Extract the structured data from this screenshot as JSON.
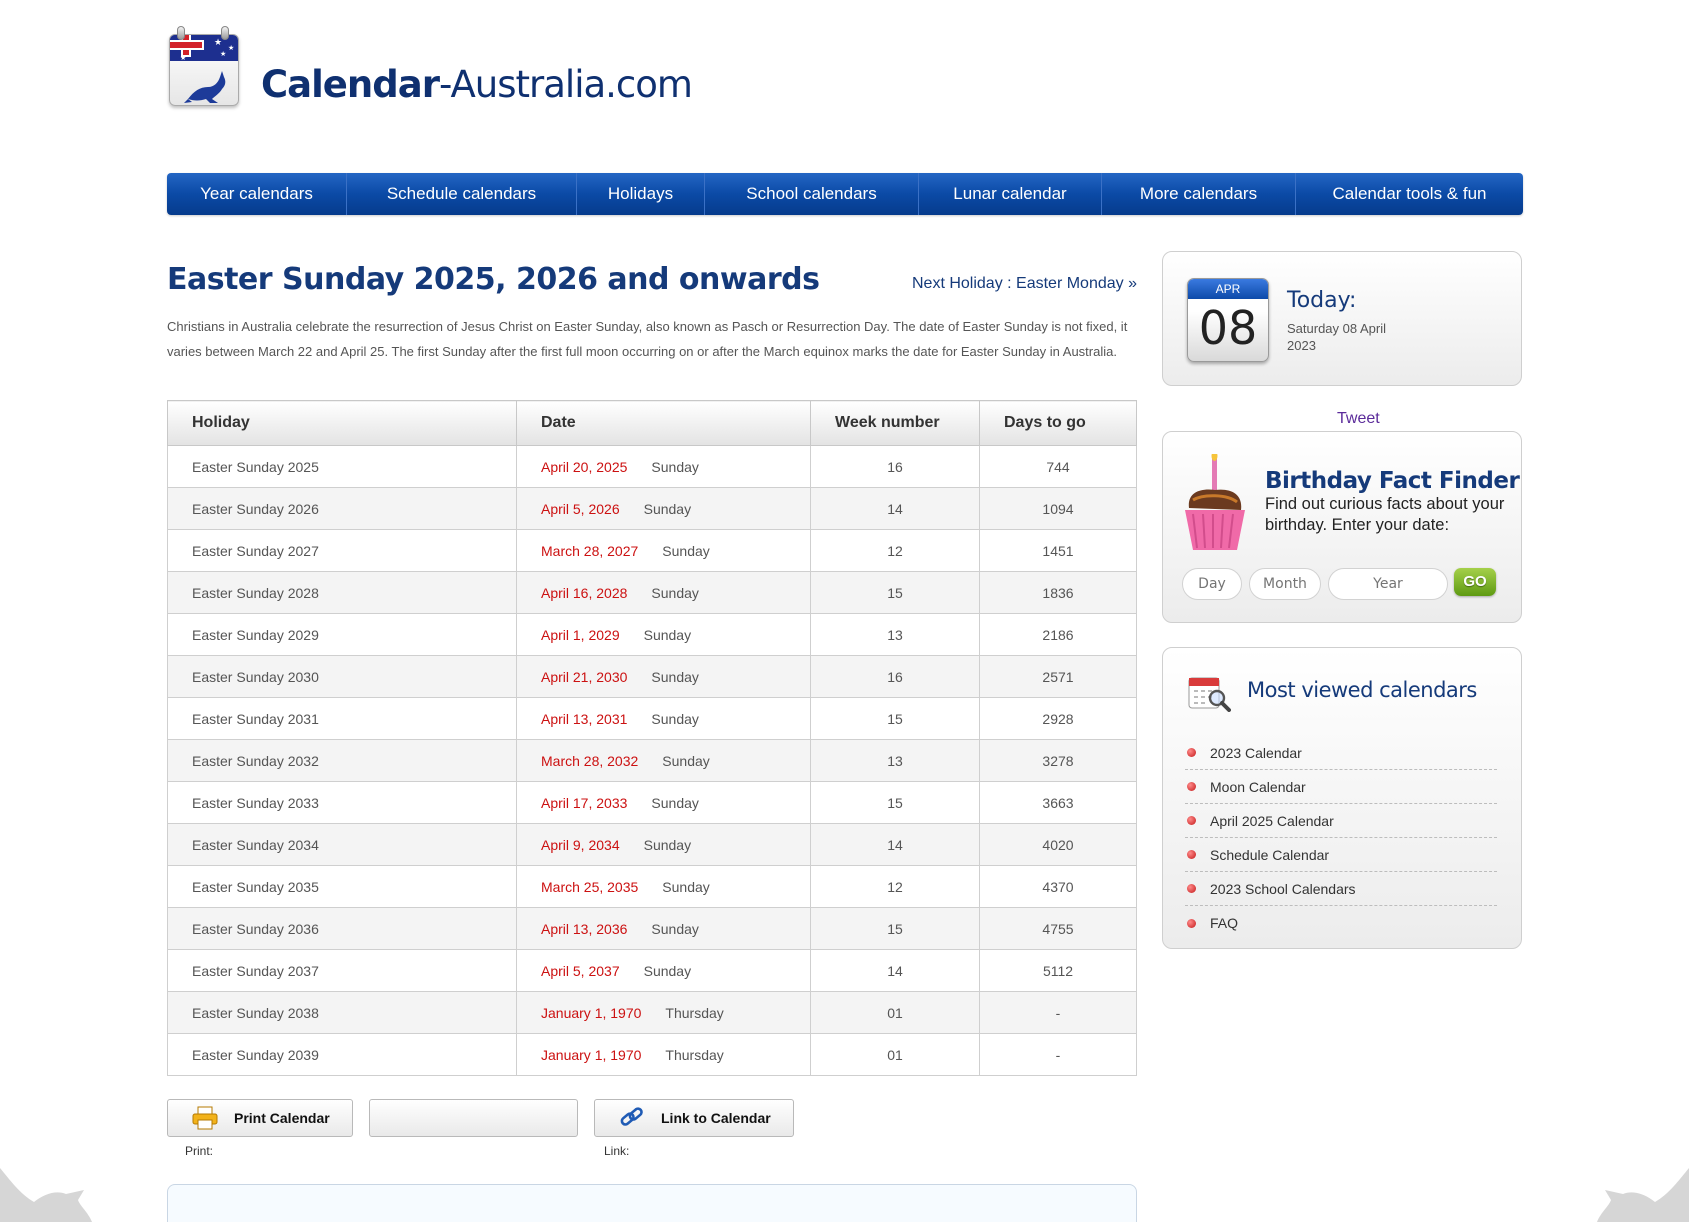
{
  "logo": {
    "bold": "Calendar",
    "rest": "-Australia.com"
  },
  "nav": [
    "Year calendars",
    "Schedule calendars",
    "Holidays",
    "School calendars",
    "Lunar calendar",
    "More calendars",
    "Calendar tools & fun"
  ],
  "main": {
    "title": "Easter Sunday 2025, 2026 and onwards",
    "next_holiday": "Next Holiday : Easter Monday »",
    "intro": "Christians in Australia celebrate the resurrection of Jesus Christ on Easter Sunday, also known as Pasch or Resurrection Day. The date of Easter Sunday is not fixed, it varies between March 22 and April 25. The first Sunday after the first full moon occurring on or after the March equinox marks the date for Easter Sunday in Australia.",
    "table": {
      "headers": [
        "Holiday",
        "Date",
        "Week number",
        "Days to go"
      ],
      "rows": [
        {
          "holiday": "Easter Sunday 2025",
          "date": "April 20, 2025",
          "weekday": "Sunday",
          "week": "16",
          "days": "744"
        },
        {
          "holiday": "Easter Sunday 2026",
          "date": "April 5, 2026",
          "weekday": "Sunday",
          "week": "14",
          "days": "1094"
        },
        {
          "holiday": "Easter Sunday 2027",
          "date": "March 28, 2027",
          "weekday": "Sunday",
          "week": "12",
          "days": "1451"
        },
        {
          "holiday": "Easter Sunday 2028",
          "date": "April 16, 2028",
          "weekday": "Sunday",
          "week": "15",
          "days": "1836"
        },
        {
          "holiday": "Easter Sunday 2029",
          "date": "April 1, 2029",
          "weekday": "Sunday",
          "week": "13",
          "days": "2186"
        },
        {
          "holiday": "Easter Sunday 2030",
          "date": "April 21, 2030",
          "weekday": "Sunday",
          "week": "16",
          "days": "2571"
        },
        {
          "holiday": "Easter Sunday 2031",
          "date": "April 13, 2031",
          "weekday": "Sunday",
          "week": "15",
          "days": "2928"
        },
        {
          "holiday": "Easter Sunday 2032",
          "date": "March 28, 2032",
          "weekday": "Sunday",
          "week": "13",
          "days": "3278"
        },
        {
          "holiday": "Easter Sunday 2033",
          "date": "April 17, 2033",
          "weekday": "Sunday",
          "week": "15",
          "days": "3663"
        },
        {
          "holiday": "Easter Sunday 2034",
          "date": "April 9, 2034",
          "weekday": "Sunday",
          "week": "14",
          "days": "4020"
        },
        {
          "holiday": "Easter Sunday 2035",
          "date": "March 25, 2035",
          "weekday": "Sunday",
          "week": "12",
          "days": "4370"
        },
        {
          "holiday": "Easter Sunday 2036",
          "date": "April 13, 2036",
          "weekday": "Sunday",
          "week": "15",
          "days": "4755"
        },
        {
          "holiday": "Easter Sunday 2037",
          "date": "April 5, 2037",
          "weekday": "Sunday",
          "week": "14",
          "days": "5112"
        },
        {
          "holiday": "Easter Sunday 2038",
          "date": "January 1, 1970",
          "weekday": "Thursday",
          "week": "01",
          "days": "-"
        },
        {
          "holiday": "Easter Sunday 2039",
          "date": "January 1, 1970",
          "weekday": "Thursday",
          "week": "01",
          "days": "-"
        }
      ]
    },
    "buttons": {
      "print": "Print Calendar",
      "print_label": "Print:",
      "link": "Link to Calendar",
      "link_label": "Link:"
    }
  },
  "sidebar": {
    "today": {
      "month": "APR",
      "day": "08",
      "title": "Today:",
      "date_line": "Saturday 08 April 2023"
    },
    "tweet": "Tweet",
    "birthday": {
      "title": "Birthday Fact Finder",
      "text": "Find out curious facts about your birthday. Enter your date:",
      "day_placeholder": "Day",
      "month_placeholder": "Month",
      "year_placeholder": "Year",
      "go": "GO"
    },
    "most_viewed": {
      "title": "Most viewed calendars",
      "items": [
        "2023 Calendar",
        "Moon Calendar",
        "April 2025 Calendar",
        "Schedule Calendar",
        "2023 School Calendars",
        "FAQ"
      ]
    }
  },
  "colors": {
    "nav": "#0b4aa6",
    "title": "#153a7a",
    "date_red": "#cc1111",
    "go_green": "#6fa51c"
  }
}
